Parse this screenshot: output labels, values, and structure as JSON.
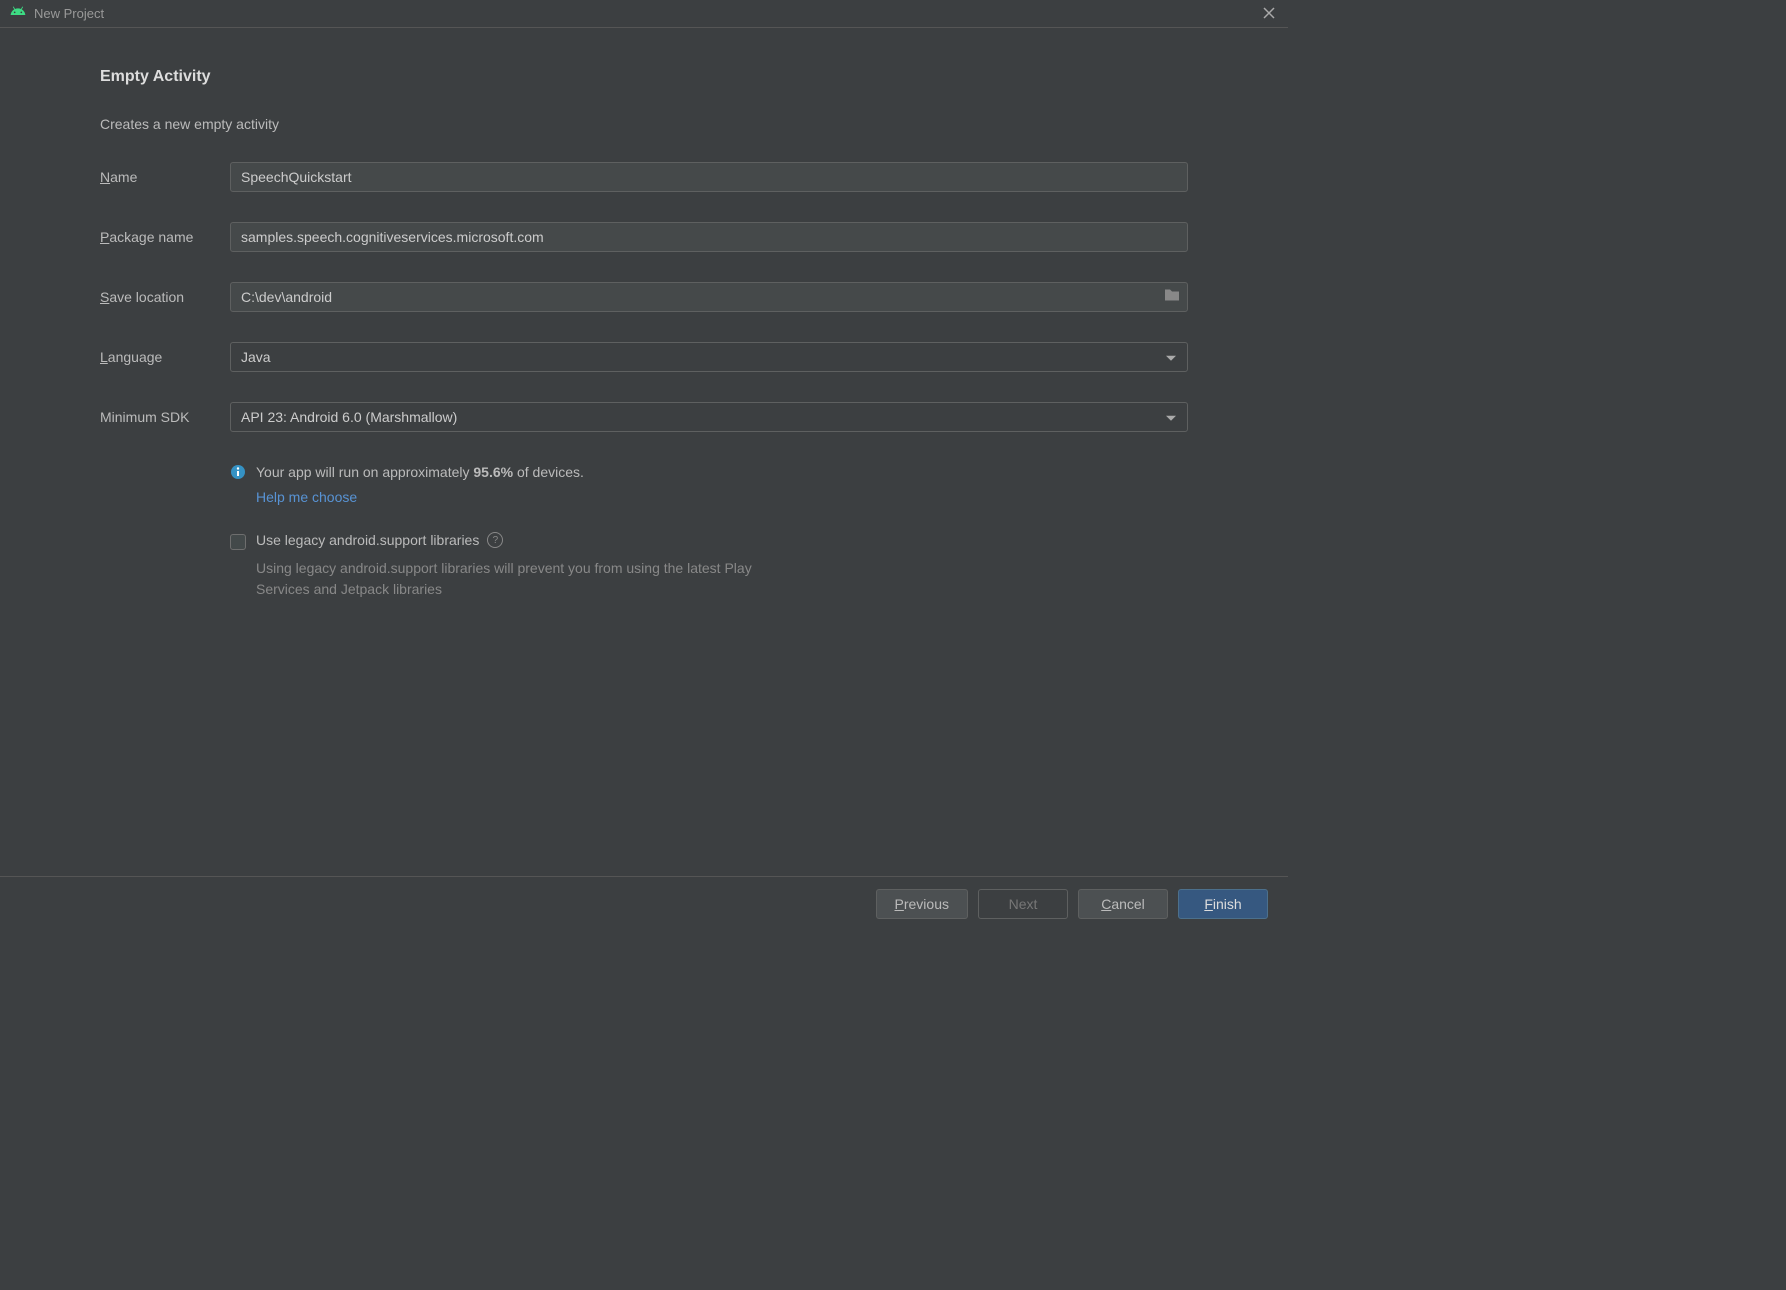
{
  "titlebar": {
    "title": "New Project"
  },
  "page": {
    "heading": "Empty Activity",
    "subtitle": "Creates a new empty activity"
  },
  "form": {
    "name_label": "ame",
    "name_mnemonic": "N",
    "name_value": "SpeechQuickstart",
    "package_label": "ackage name",
    "package_mnemonic": "P",
    "package_value": "samples.speech.cognitiveservices.microsoft.com",
    "location_label": "ave location",
    "location_mnemonic": "S",
    "location_value": "C:\\dev\\android",
    "language_label": "anguage",
    "language_mnemonic": "L",
    "language_value": "Java",
    "minsdk_label": "Minimum SDK",
    "minsdk_value": "API 23: Android 6.0 (Marshmallow)"
  },
  "info": {
    "prefix": "Your app will run on approximately ",
    "percent": "95.6%",
    "suffix": " of devices.",
    "help_link": "Help me choose"
  },
  "legacy": {
    "label": "Use legacy android.support libraries",
    "desc": "Using legacy android.support libraries will prevent you from using the latest Play Services and Jetpack libraries"
  },
  "buttons": {
    "previous_mnemonic": "P",
    "previous_label": "revious",
    "next_label": "Next",
    "cancel_mnemonic": "C",
    "cancel_label": "ancel",
    "finish_mnemonic": "F",
    "finish_label": "inish"
  }
}
